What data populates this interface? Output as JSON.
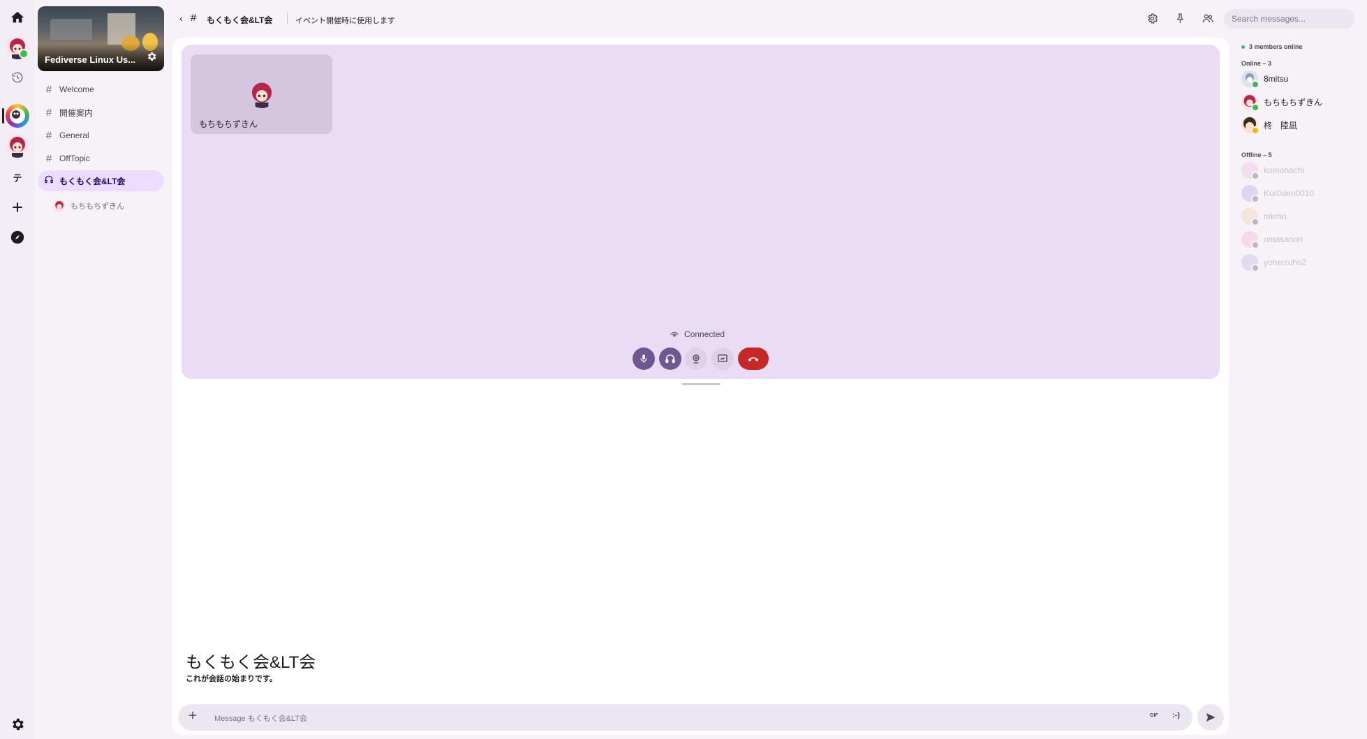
{
  "server_rail": {
    "items": [
      "home-icon",
      "dm-avatar",
      "history-icon",
      "server-fediverse",
      "server-avatar",
      "server-te",
      "add-server-icon",
      "explore-icon"
    ],
    "te_label": "テ",
    "status_online_color": "#3fb950"
  },
  "server": {
    "name": "Fediverse Linux Us...",
    "channels": [
      {
        "label": "Welcome",
        "type": "text"
      },
      {
        "label": "開催案内",
        "type": "text"
      },
      {
        "label": "General",
        "type": "text"
      },
      {
        "label": "OffTopic",
        "type": "text"
      },
      {
        "label": "もくもく会&LT会",
        "type": "voice",
        "active": true
      }
    ],
    "voice_participant": "もちもちずきん"
  },
  "header": {
    "channel_name": "もくもく会&LT会",
    "topic": "イベント開催時に使用します",
    "search_placeholder": "Search messages..."
  },
  "voice": {
    "tile_name": "もちもちずきん",
    "status": "Connected",
    "accent": "#6f5892",
    "hangup_color": "#c62828"
  },
  "chat": {
    "intro_title": "もくもく会&LT会",
    "intro_sub": "これが会話の始まりです。",
    "composer_placeholder": "Message もくもく会&LT会",
    "gif_label": "GIF",
    "emoji_label": ":-)"
  },
  "members": {
    "online_count_label": "3 members online",
    "online_header": "Online – 3",
    "offline_header": "Offline – 5",
    "online": [
      "8mitsu",
      "もちもちずきん",
      "柊　陸凪"
    ],
    "offline": [
      "komohachi",
      "Kur0den0010",
      "mkmn",
      "omasanori",
      "yoheizuho2"
    ]
  }
}
